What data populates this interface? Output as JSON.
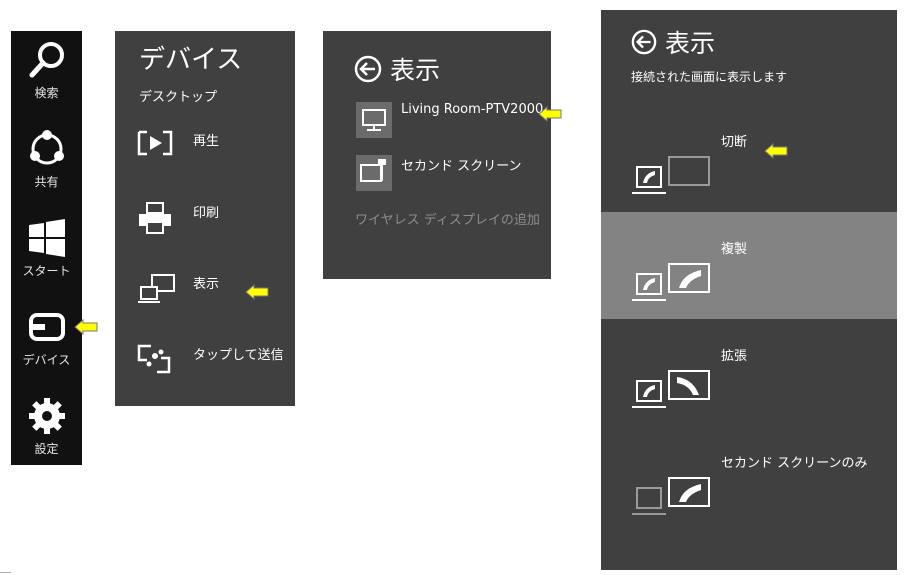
{
  "charms": {
    "search": "検索",
    "share": "共有",
    "start": "スタート",
    "devices": "デバイス",
    "settings": "設定"
  },
  "devices_panel": {
    "title": "デバイス",
    "subtitle": "デスクトップ",
    "items": [
      "再生",
      "印刷",
      "表示",
      "タップして送信"
    ]
  },
  "project_panel": {
    "title": "表示",
    "devices": [
      "Living Room-PTV2000",
      "セカンド スクリーン"
    ],
    "add_wireless": "ワイヤレス ディスプレイの追加"
  },
  "project_modes_panel": {
    "title": "表示",
    "description": "接続された画面に表示します",
    "modes": [
      "切断",
      "複製",
      "拡張",
      "セカンド スクリーンのみ"
    ],
    "selected_mode": "複製"
  },
  "colors": {
    "charms_bg": "#111111",
    "panel_bg": "#404040",
    "selected_bg": "#838383",
    "arrow_fill": "#ffff00"
  }
}
